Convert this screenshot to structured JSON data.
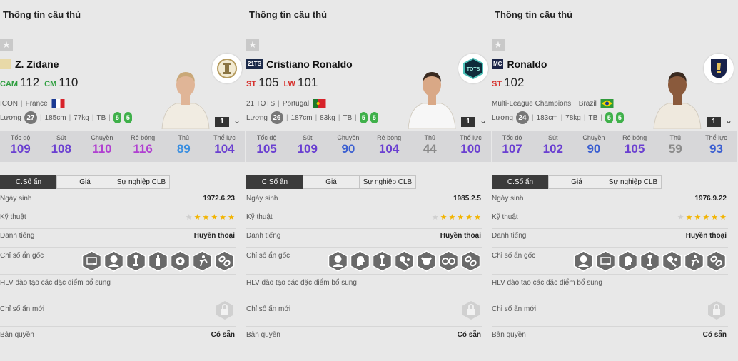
{
  "panels": [
    {
      "title": "Thông tin cầu thủ",
      "season_badge": "",
      "season_badge_color": "#e8d9a8",
      "name": "Z. Zidane",
      "positions": [
        {
          "label": "CAM",
          "value": "112",
          "color": "#2e9e3f"
        },
        {
          "label": "CM",
          "value": "110",
          "color": "#2e9e3f"
        }
      ],
      "meta": [
        "ICON",
        "France"
      ],
      "flag": "france",
      "wage_label": "Lương",
      "wage": "27",
      "height": "185cm",
      "weight": "77kg",
      "body": "TB",
      "feet": [
        "5",
        "5"
      ],
      "team_logo": "icon-logo",
      "level": "1",
      "attrs": [
        {
          "label": "Tốc độ",
          "value": "109",
          "color": "#6a3fd1"
        },
        {
          "label": "Sút",
          "value": "108",
          "color": "#6a3fd1"
        },
        {
          "label": "Chuyền",
          "value": "110",
          "color": "#b03fd1"
        },
        {
          "label": "Rê bóng",
          "value": "116",
          "color": "#b03fd1"
        },
        {
          "label": "Thủ",
          "value": "89",
          "color": "#3b8fe0"
        },
        {
          "label": "Thể lực",
          "value": "104",
          "color": "#6a3fd1"
        }
      ],
      "tabs": [
        "C.Số ẩn",
        "Giá",
        "Sự nghiệp CLB"
      ],
      "birthday_label": "Ngày sinh",
      "birthday": "1972.6.23",
      "skill_label": "Kỹ thuật",
      "skill_stars": 5,
      "rep_label": "Danh tiếng",
      "rep": "Huyền thoại",
      "traits_label": "Chỉ số ẩn gốc",
      "traits": [
        "goal-icon",
        "head-icon",
        "trophy-icon",
        "bottle-icon",
        "ball-icon",
        "shield-run-icon",
        "chain-icon"
      ],
      "coach_label": "HLV đào tạo các đặc điểm bổ sung",
      "new_label": "Chỉ số ẩn mới",
      "owner_label": "Bản quyền",
      "owner": "Có sẵn"
    },
    {
      "title": "Thông tin cầu thủ",
      "season_badge": "21TS",
      "season_badge_color": "#1c2a4a",
      "name": "Cristiano Ronaldo",
      "positions": [
        {
          "label": "ST",
          "value": "105",
          "color": "#d6322e"
        },
        {
          "label": "LW",
          "value": "101",
          "color": "#d6322e"
        }
      ],
      "meta": [
        "21 TOTS",
        "Portugal"
      ],
      "flag": "portugal",
      "wage_label": "Lương",
      "wage": "26",
      "height": "187cm",
      "weight": "83kg",
      "body": "TB",
      "feet": [
        "5",
        "5"
      ],
      "team_logo": "tots-logo",
      "level": "1",
      "attrs": [
        {
          "label": "Tốc độ",
          "value": "105",
          "color": "#6a3fd1"
        },
        {
          "label": "Sút",
          "value": "109",
          "color": "#6a3fd1"
        },
        {
          "label": "Chuyền",
          "value": "90",
          "color": "#3b5fd1"
        },
        {
          "label": "Rê bóng",
          "value": "104",
          "color": "#6a3fd1"
        },
        {
          "label": "Thủ",
          "value": "44",
          "color": "#8a8a8a"
        },
        {
          "label": "Thể lực",
          "value": "100",
          "color": "#6a3fd1"
        }
      ],
      "tabs": [
        "C.Số ẩn",
        "Giá",
        "Sự nghiệp CLB"
      ],
      "birthday_label": "Ngày sinh",
      "birthday": "1985.2.5",
      "skill_label": "Kỹ thuật",
      "skill_stars": 5,
      "rep_label": "Danh tiếng",
      "rep": "Huyền thoại",
      "traits_label": "Chỉ số ẩn gốc",
      "traits": [
        "head-icon",
        "head-profile-icon",
        "trophy-icon",
        "ball-kick-icon",
        "bull-icon",
        "chain-dribble-icon",
        "chain-icon"
      ],
      "coach_label": "HLV đào tạo các đặc điểm bổ sung",
      "new_label": "Chỉ số ẩn mới",
      "owner_label": "Bản quyền",
      "owner": "Có sẵn"
    },
    {
      "title": "Thông tin cầu thủ",
      "season_badge": "MC",
      "season_badge_color": "#1b2447",
      "name": "Ronaldo",
      "positions": [
        {
          "label": "ST",
          "value": "102",
          "color": "#d6322e"
        }
      ],
      "meta": [
        "Multi-League Champions",
        "Brazil"
      ],
      "flag": "brazil",
      "wage_label": "Lương",
      "wage": "24",
      "height": "183cm",
      "weight": "78kg",
      "body": "TB",
      "feet": [
        "5",
        "5"
      ],
      "team_logo": "mc-logo",
      "level": "1",
      "attrs": [
        {
          "label": "Tốc độ",
          "value": "107",
          "color": "#6a3fd1"
        },
        {
          "label": "Sút",
          "value": "102",
          "color": "#6a3fd1"
        },
        {
          "label": "Chuyền",
          "value": "90",
          "color": "#3b5fd1"
        },
        {
          "label": "Rê bóng",
          "value": "105",
          "color": "#6a3fd1"
        },
        {
          "label": "Thủ",
          "value": "59",
          "color": "#8a8a8a"
        },
        {
          "label": "Thể lực",
          "value": "93",
          "color": "#3b5fd1"
        }
      ],
      "tabs": [
        "C.Số ẩn",
        "Giá",
        "Sự nghiệp CLB"
      ],
      "birthday_label": "Ngày sinh",
      "birthday": "1976.9.22",
      "skill_label": "Kỹ thuật",
      "skill_stars": 5,
      "rep_label": "Danh tiếng",
      "rep": "Huyền thoại",
      "traits_label": "Chỉ số ẩn gốc",
      "traits": [
        "head-icon",
        "goal-icon",
        "head-profile-icon",
        "trophy-icon",
        "ball-kick-icon",
        "shield-run-icon",
        "chain-icon"
      ],
      "coach_label": "HLV đào tạo các đặc điểm bổ sung",
      "new_label": "Chỉ số ẩn mới",
      "owner_label": "Bản quyền",
      "owner": "Có sẵn"
    }
  ]
}
